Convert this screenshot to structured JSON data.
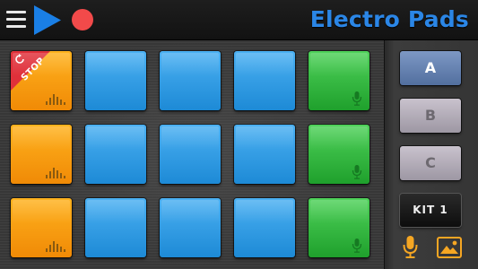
{
  "header": {
    "title": "Electro Pads"
  },
  "pads": {
    "stop_label": "STOP"
  },
  "kit_panel": {
    "buttons": [
      "A",
      "B",
      "C"
    ],
    "kit_label": "KIT 1"
  },
  "colors": {
    "title": "#2b86e6",
    "play": "#1a7fe6",
    "record": "#f24a4a",
    "pad_blue": "#2a9ae2",
    "pad_green": "#2fb83b",
    "pad_orange": "#f79a10",
    "stop_ribbon": "#e0303a",
    "accent_icons": "#f5a623"
  },
  "icons": [
    "menu-icon",
    "play-icon",
    "record-icon",
    "stop-loop-icon",
    "equalizer-icon",
    "microphone-icon",
    "image-icon"
  ]
}
